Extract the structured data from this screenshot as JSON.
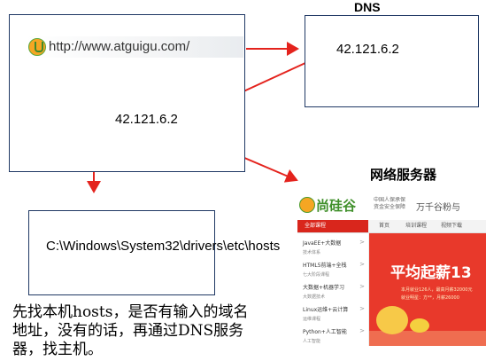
{
  "browser": {
    "url": "http://www.atguigu.com/"
  },
  "dns": {
    "title": "DNS",
    "ip": "42.121.6.2"
  },
  "resolved_ip": "42.121.6.2",
  "hosts_path": "C:\\Windows\\System32\\drivers\\etc\\hosts",
  "web_server": {
    "title": "网络服务器"
  },
  "description": "先找本机hosts，是否有输入的域名地址，没有的话，再通过DNS服务器，找主机。",
  "site": {
    "brand": "尚硅谷",
    "subtitle": "中国人保承保 资金安全保障",
    "slogan": "万千谷粉与",
    "nav_category": "全部课程",
    "nav_items": [
      "首页",
      "培训课程",
      "视频下载"
    ],
    "menu": [
      {
        "title": "JavaEE+大数据",
        "sub": "技术体系"
      },
      {
        "title": "HTML5前端+全栈",
        "sub": "七大阶段课程"
      },
      {
        "title": "大数据+机器学习",
        "sub": "大数据技术"
      },
      {
        "title": "Linux运维+云计算",
        "sub": "运维课程"
      },
      {
        "title": "Python+人工智能",
        "sub": "人工智能"
      }
    ],
    "banner_big": "平均起薪13",
    "banner_line1": "本月就业126人，最高月薪32000元",
    "banner_line2": "就业明星：方**，月薪26000"
  },
  "colors": {
    "arrow": "#e4231d",
    "box_border": "#1f3864",
    "banner": "#e8392b",
    "brand_green": "#3f8f2a"
  }
}
